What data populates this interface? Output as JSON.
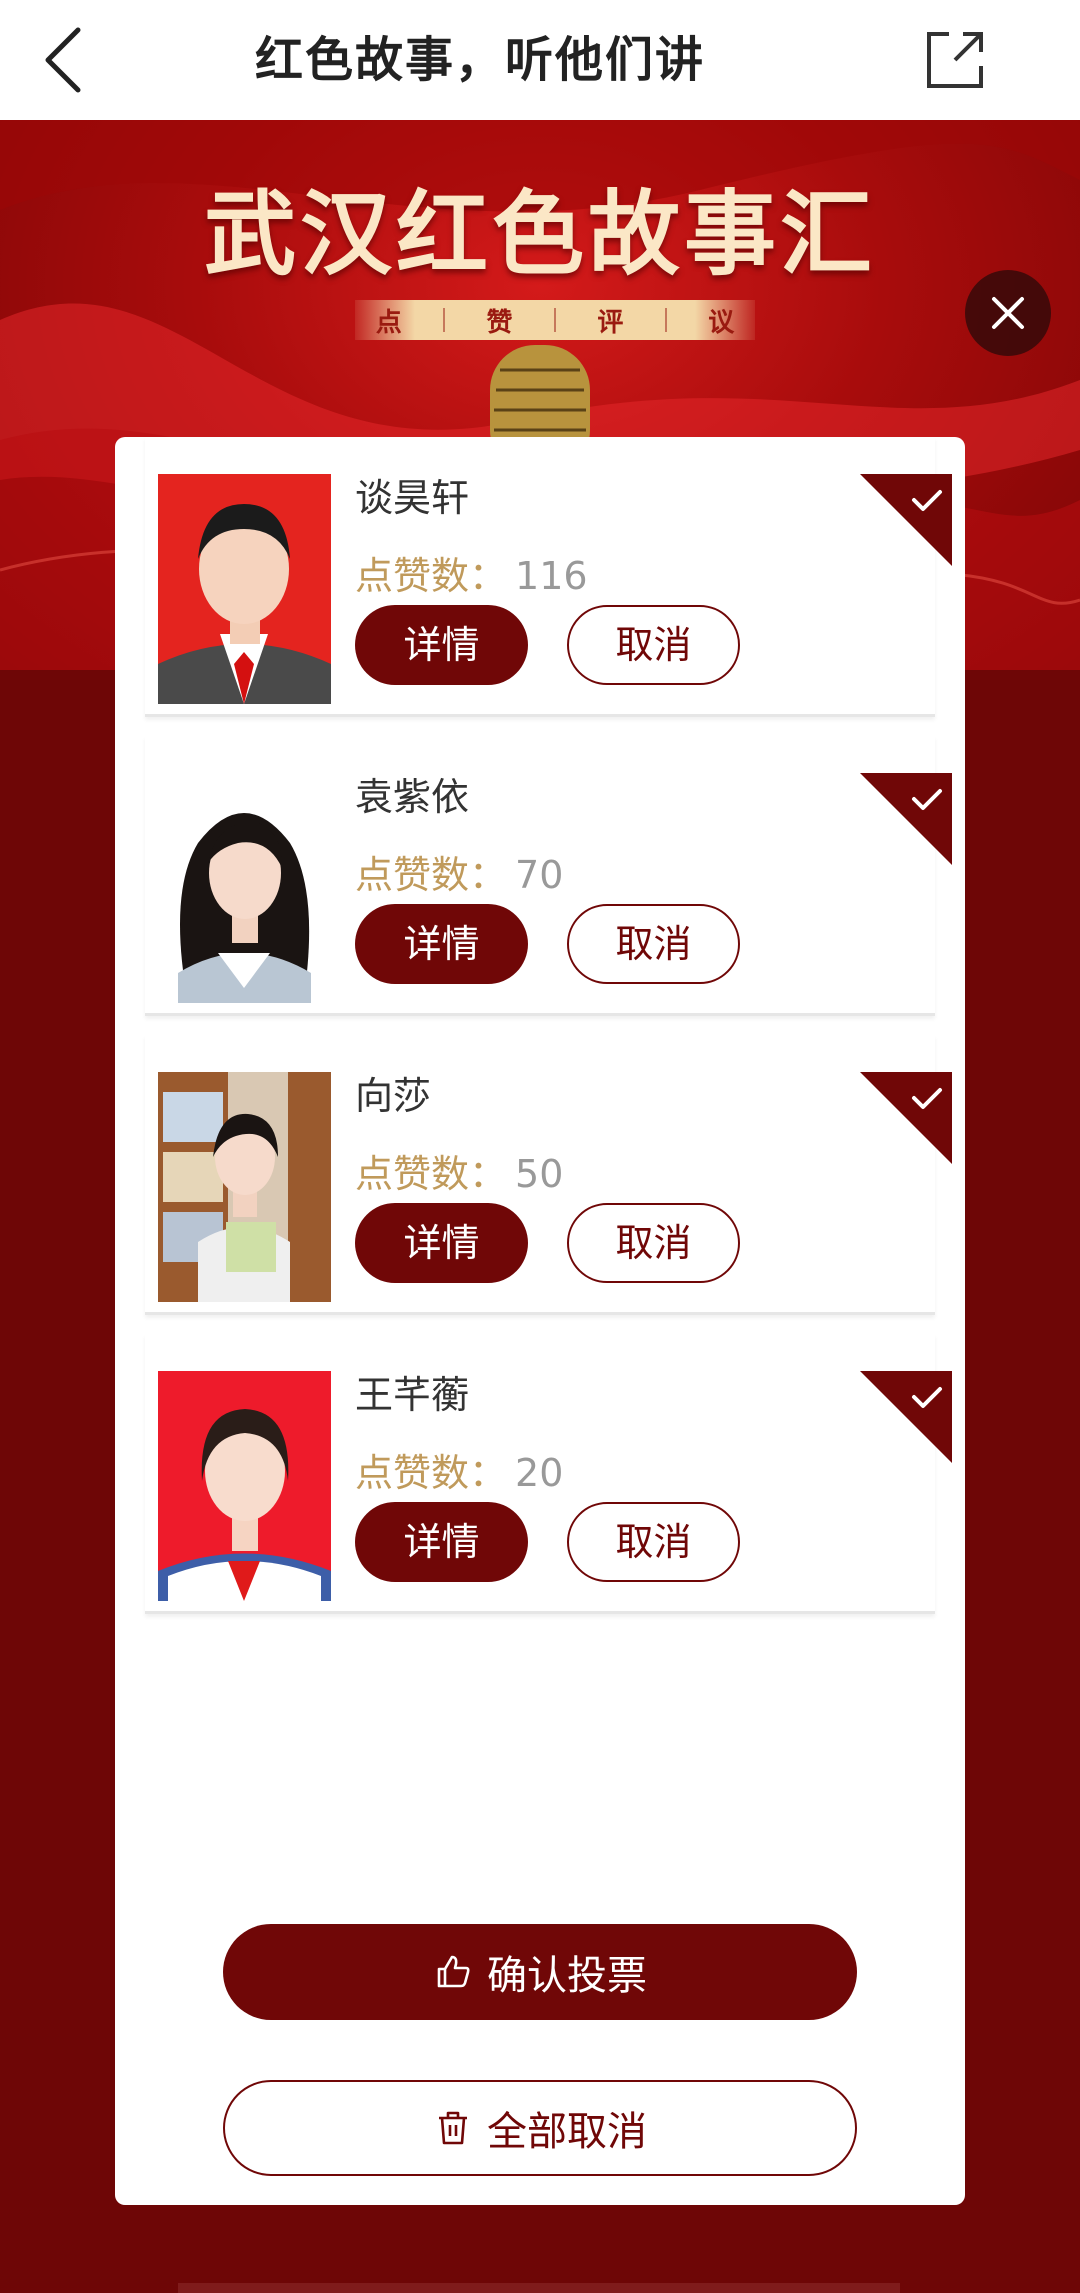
{
  "nav": {
    "title": "红色故事，听他们讲"
  },
  "banner": {
    "title": "武汉红色故事汇",
    "tagline": [
      "点",
      "赞",
      "评",
      "议"
    ]
  },
  "candidates": [
    {
      "name": "谈昊轩",
      "likes_label": "点赞数：",
      "likes": "116",
      "detail_label": "详情",
      "cancel_label": "取消",
      "selected": true
    },
    {
      "name": "袁紫依",
      "likes_label": "点赞数：",
      "likes": "70",
      "detail_label": "详情",
      "cancel_label": "取消",
      "selected": true
    },
    {
      "name": "向莎",
      "likes_label": "点赞数：",
      "likes": "50",
      "detail_label": "详情",
      "cancel_label": "取消",
      "selected": true
    },
    {
      "name": "王芊蘅",
      "likes_label": "点赞数：",
      "likes": "20",
      "detail_label": "详情",
      "cancel_label": "取消",
      "selected": true
    }
  ],
  "actions": {
    "confirm_label": "确认投票",
    "clear_label": "全部取消"
  },
  "colors": {
    "primary": "#700707",
    "accent_gold": "#c09a5b",
    "background": "#6e0606"
  }
}
